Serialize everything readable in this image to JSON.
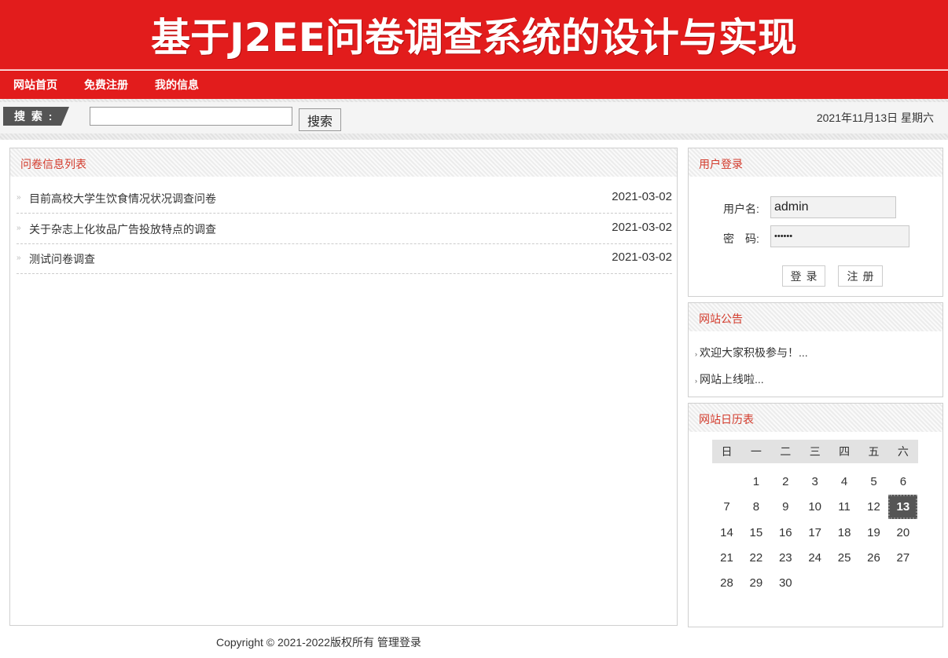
{
  "header": {
    "title": "基于J2EE问卷调查系统的设计与实现"
  },
  "nav": {
    "items": [
      {
        "label": "网站首页"
      },
      {
        "label": "免费注册"
      },
      {
        "label": "我的信息"
      }
    ]
  },
  "search": {
    "label": "搜 索 :",
    "value": "",
    "placeholder": "",
    "button": "搜索"
  },
  "date": "2021年11月13日 星期六",
  "main": {
    "title": "问卷信息列表",
    "items": [
      {
        "title": "目前高校大学生饮食情况状况调查问卷",
        "date": "2021-03-02"
      },
      {
        "title": "关于杂志上化妆品广告投放特点的调查",
        "date": "2021-03-02"
      },
      {
        "title": "测试问卷调查",
        "date": "2021-03-02"
      }
    ]
  },
  "login": {
    "title": "用户登录",
    "username_label": "用户名:",
    "username_value": "admin",
    "password_label": "密　码:",
    "password_value": "••••••",
    "login_button": "登录",
    "register_button": "注册"
  },
  "notice": {
    "title": "网站公告",
    "items": [
      {
        "text": "欢迎大家积极参与！..."
      },
      {
        "text": "网站上线啦..."
      }
    ]
  },
  "calendar": {
    "title": "网站日历表",
    "weekdays": [
      "日",
      "一",
      "二",
      "三",
      "四",
      "五",
      "六"
    ],
    "today": "13",
    "weeks": [
      [
        "",
        "1",
        "2",
        "3",
        "4",
        "5",
        "6"
      ],
      [
        "7",
        "8",
        "9",
        "10",
        "11",
        "12",
        "13"
      ],
      [
        "14",
        "15",
        "16",
        "17",
        "18",
        "19",
        "20"
      ],
      [
        "21",
        "22",
        "23",
        "24",
        "25",
        "26",
        "27"
      ],
      [
        "28",
        "29",
        "30",
        "",
        "",
        "",
        ""
      ]
    ]
  },
  "footer": {
    "copyright": "Copyright © 2021-2022版权所有",
    "admin_link": "管理登录"
  },
  "colors": {
    "brand_red": "#e21c1c",
    "title_red": "#d33b2c"
  }
}
